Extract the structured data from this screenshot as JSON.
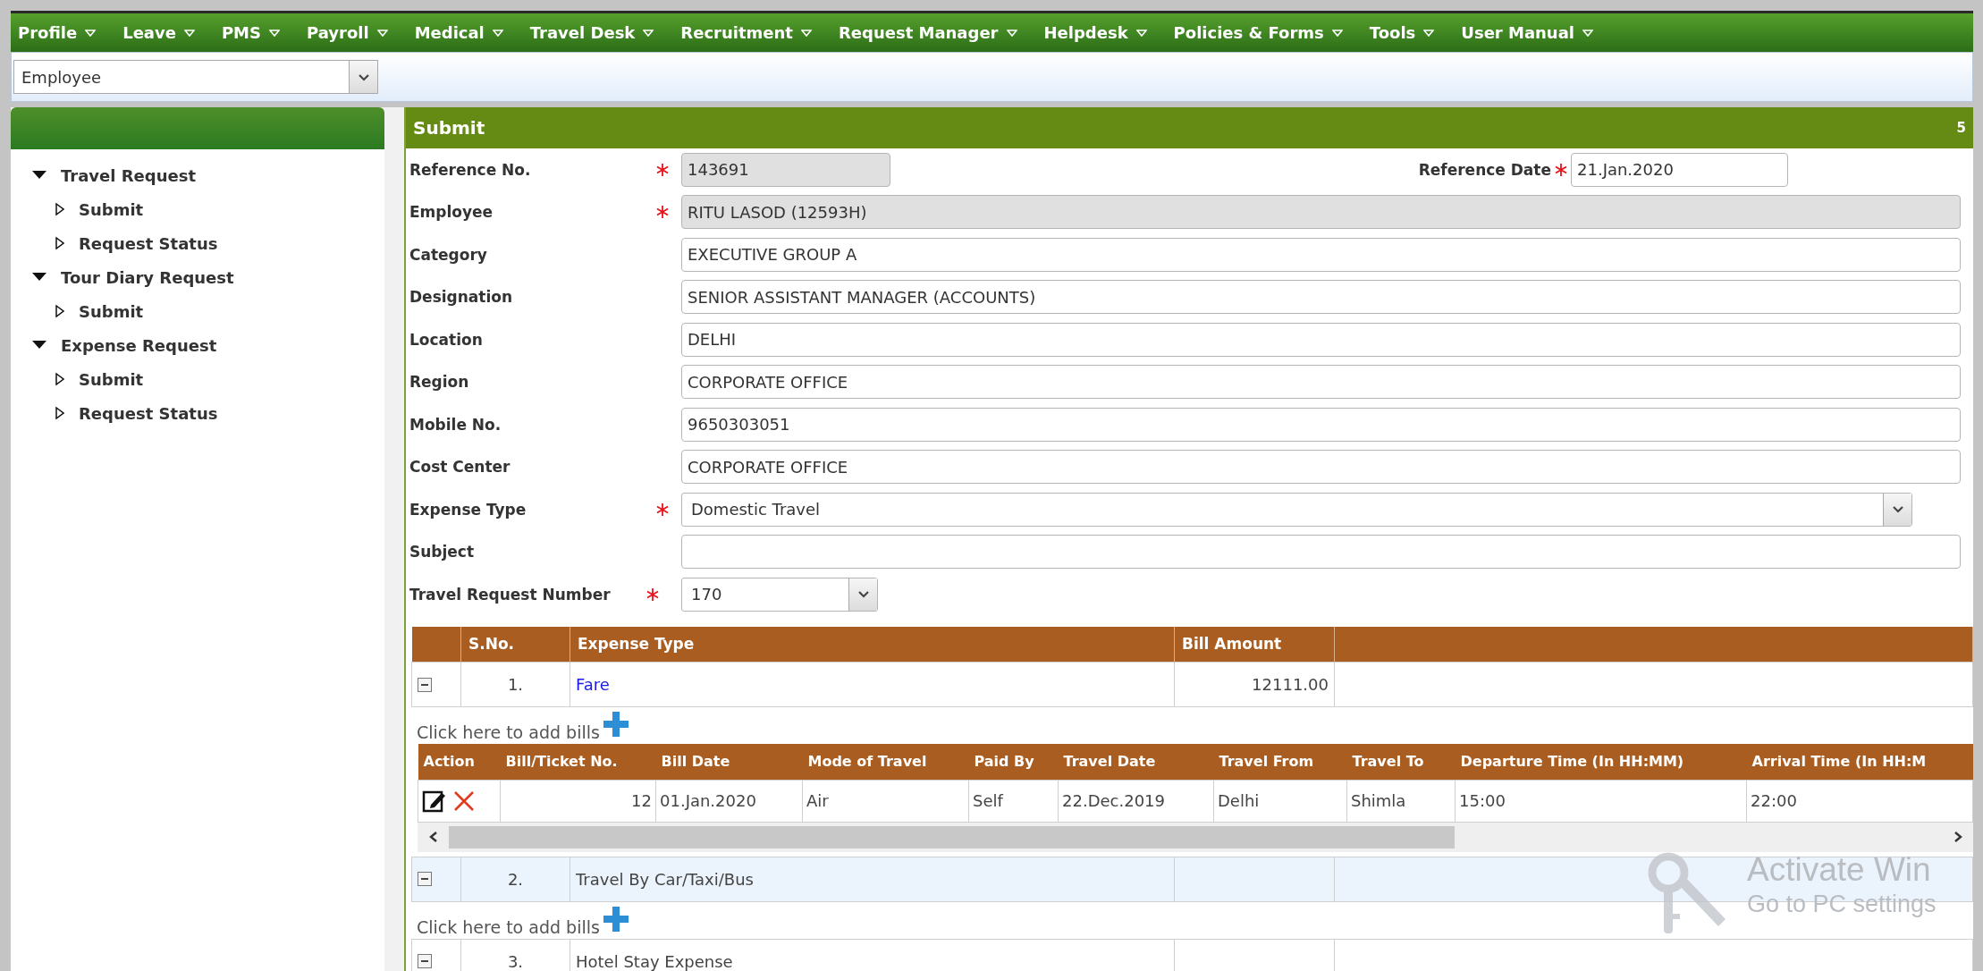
{
  "menu": [
    {
      "label": "Profile"
    },
    {
      "label": "Leave"
    },
    {
      "label": "PMS"
    },
    {
      "label": "Payroll"
    },
    {
      "label": "Medical"
    },
    {
      "label": "Travel Desk"
    },
    {
      "label": "Recruitment"
    },
    {
      "label": "Request Manager"
    },
    {
      "label": "Helpdesk"
    },
    {
      "label": "Policies & Forms"
    },
    {
      "label": "Tools"
    },
    {
      "label": "User Manual"
    }
  ],
  "role_select": {
    "value": "Employee"
  },
  "sidebar": {
    "items": [
      {
        "label": "Travel Request",
        "expanded": true,
        "children": [
          {
            "label": "Submit"
          },
          {
            "label": "Request Status"
          }
        ]
      },
      {
        "label": "Tour Diary Request",
        "expanded": true,
        "children": [
          {
            "label": "Submit"
          }
        ]
      },
      {
        "label": "Expense Request",
        "expanded": true,
        "children": [
          {
            "label": "Submit"
          },
          {
            "label": "Request Status"
          }
        ]
      }
    ]
  },
  "panel": {
    "title": "Submit",
    "badge": "5"
  },
  "reference": {
    "label": "Reference No.",
    "required": true,
    "disabled": true,
    "value": "143691",
    "date_label": "Reference Date",
    "date_required": true,
    "date_value": "21.Jan.2020"
  },
  "fields": [
    {
      "label": "Employee",
      "required": true,
      "disabled": true,
      "kind": "text",
      "value": "RITU LASOD (12593H)"
    },
    {
      "label": "Category",
      "required": false,
      "disabled": false,
      "kind": "text",
      "value": "EXECUTIVE GROUP A"
    },
    {
      "label": "Designation",
      "required": false,
      "disabled": false,
      "kind": "text",
      "value": "SENIOR ASSISTANT MANAGER (ACCOUNTS)"
    },
    {
      "label": "Location",
      "required": false,
      "disabled": false,
      "kind": "text",
      "value": "DELHI"
    },
    {
      "label": "Region",
      "required": false,
      "disabled": false,
      "kind": "text",
      "value": "CORPORATE OFFICE"
    },
    {
      "label": "Mobile No.",
      "required": false,
      "disabled": false,
      "kind": "text",
      "value": "9650303051"
    },
    {
      "label": "Cost Center",
      "required": false,
      "disabled": false,
      "kind": "text",
      "value": "CORPORATE OFFICE"
    },
    {
      "label": "Expense Type",
      "required": true,
      "disabled": false,
      "kind": "select",
      "value": "Domestic Travel"
    },
    {
      "label": "Subject",
      "required": false,
      "disabled": false,
      "kind": "text"
    }
  ],
  "travel_request": {
    "label": "Travel Request Number",
    "required": true,
    "value": "170"
  },
  "expenses": {
    "columns": [
      "S.No.",
      "Expense Type",
      "Bill Amount"
    ],
    "rows": [
      {
        "sno": "1.",
        "type": "Fare",
        "amount": "12111.00",
        "expanded": true,
        "selected": false,
        "link": true,
        "add_bills": "Click here to add bills",
        "bills": {
          "columns": [
            "Action",
            "Bill/Ticket No.",
            "Bill Date",
            "Mode of Travel",
            "Paid By",
            "Travel Date",
            "Travel From",
            "Travel To",
            "Departure Time (In HH:MM)",
            "Arrival Time (In HH:M"
          ],
          "rows": [
            {
              "cells": [
                "",
                "12",
                "01.Jan.2020",
                "Air",
                "Self",
                "22.Dec.2019",
                "Delhi",
                "Shimla",
                "15:00",
                "22:00"
              ]
            }
          ]
        }
      },
      {
        "sno": "2.",
        "type": "Travel By Car/Taxi/Bus",
        "expanded": true,
        "selected": true,
        "link": false,
        "add_bills": "Click here to add bills"
      },
      {
        "sno": "3.",
        "type": "Hotel Stay Expense",
        "expanded": true,
        "selected": false,
        "link": false
      }
    ]
  },
  "system_overlay": {
    "title": "Activate Win",
    "subtitle": "Go to PC settings"
  }
}
